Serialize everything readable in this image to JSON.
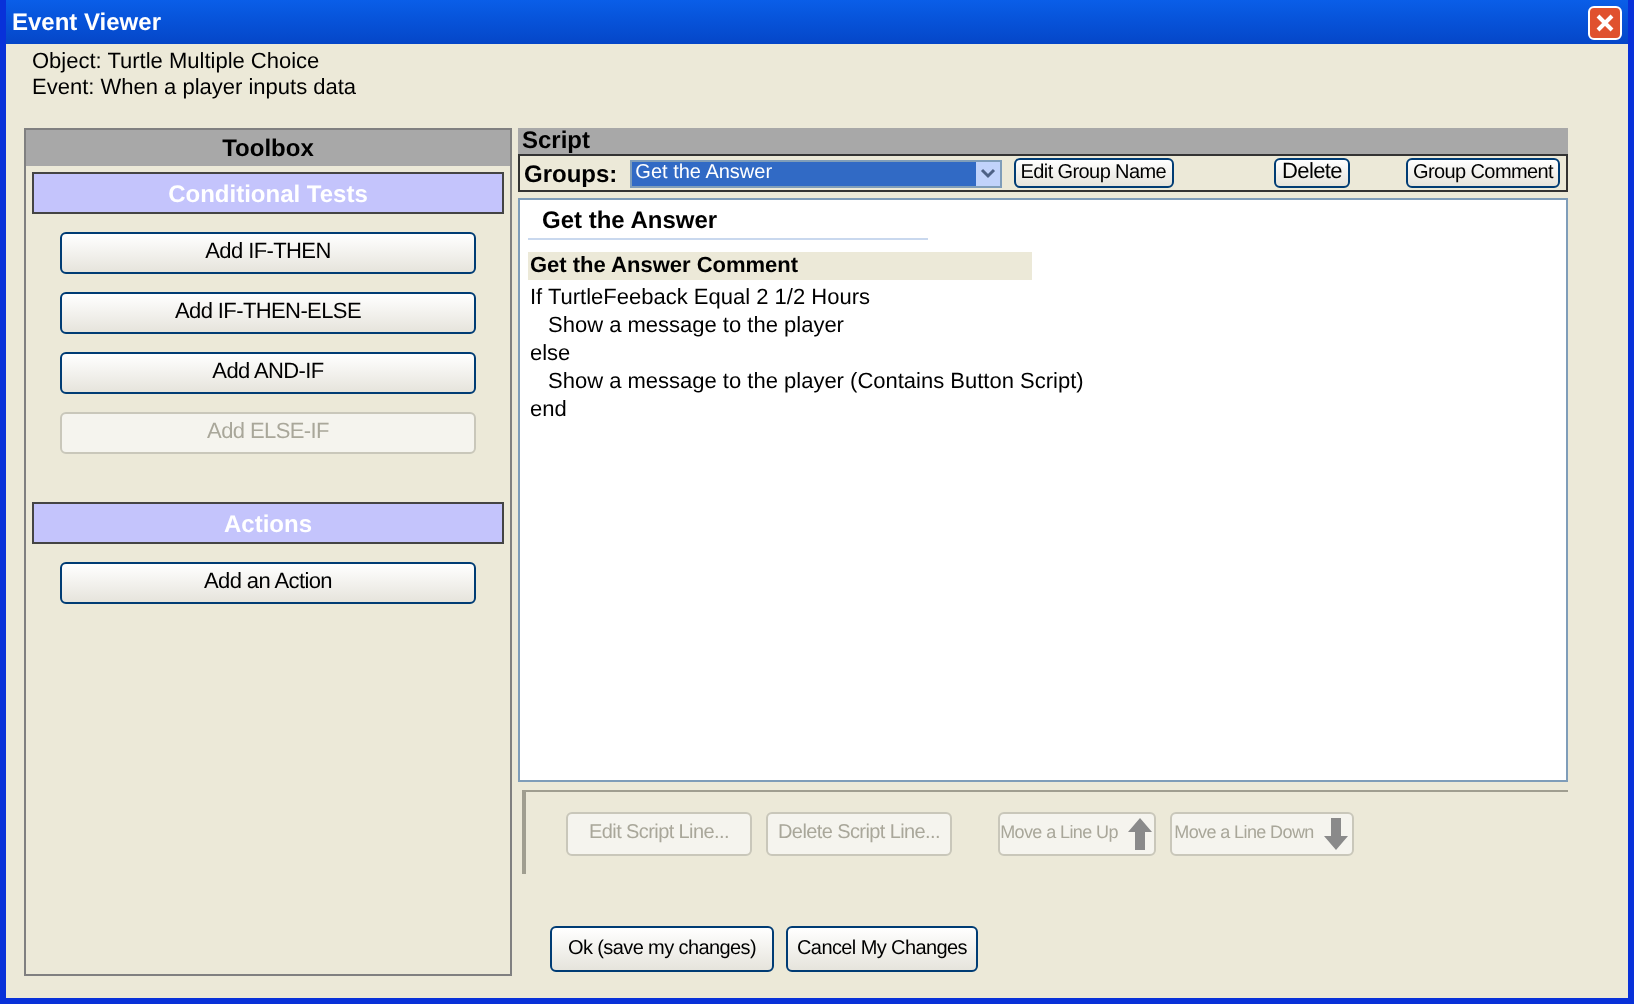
{
  "window": {
    "title": "Event Viewer"
  },
  "header": {
    "object": "Object: Turtle Multiple Choice",
    "event": "Event: When a player inputs data"
  },
  "toolbox": {
    "title": "Toolbox",
    "sections": [
      {
        "title": "Conditional Tests",
        "buttons": [
          {
            "label": "Add IF-THEN",
            "disabled": false
          },
          {
            "label": "Add IF-THEN-ELSE",
            "disabled": false
          },
          {
            "label": "Add AND-IF",
            "disabled": false
          },
          {
            "label": "Add ELSE-IF",
            "disabled": true
          }
        ]
      },
      {
        "title": "Actions",
        "buttons": [
          {
            "label": "Add an Action",
            "disabled": false
          }
        ]
      }
    ]
  },
  "script": {
    "title": "Script",
    "groups_label": "Groups:",
    "groups_value": "Get the Answer",
    "group_buttons": [
      {
        "label": "Edit Group Name"
      },
      {
        "label": "Delete"
      },
      {
        "label": "Group Comment"
      }
    ],
    "heading": "Get the Answer",
    "lines": [
      {
        "kind": "comment",
        "text": "Get the Answer Comment"
      },
      {
        "kind": "line",
        "text": "If TurtleFeeback Equal 2 1/2 Hours",
        "children": [
          {
            "kind": "line",
            "text": "Show a message to the player"
          }
        ]
      },
      {
        "kind": "line",
        "text": "else",
        "children": [
          {
            "kind": "line",
            "text": "Show a message to the player (Contains Button Script)"
          }
        ]
      },
      {
        "kind": "line",
        "text": "end"
      }
    ],
    "line_buttons": [
      {
        "label": "Edit Script Line...",
        "disabled": true,
        "kind": "plain"
      },
      {
        "label": "Delete Script Line...",
        "disabled": true,
        "kind": "plain"
      },
      {
        "label": "Move a Line Up",
        "disabled": true,
        "kind": "move_up"
      },
      {
        "label": "Move a Line Down",
        "disabled": true,
        "kind": "move_down"
      }
    ]
  },
  "footer_buttons": [
    {
      "label": "Ok (save my changes)"
    },
    {
      "label": "Cancel My Changes"
    }
  ]
}
